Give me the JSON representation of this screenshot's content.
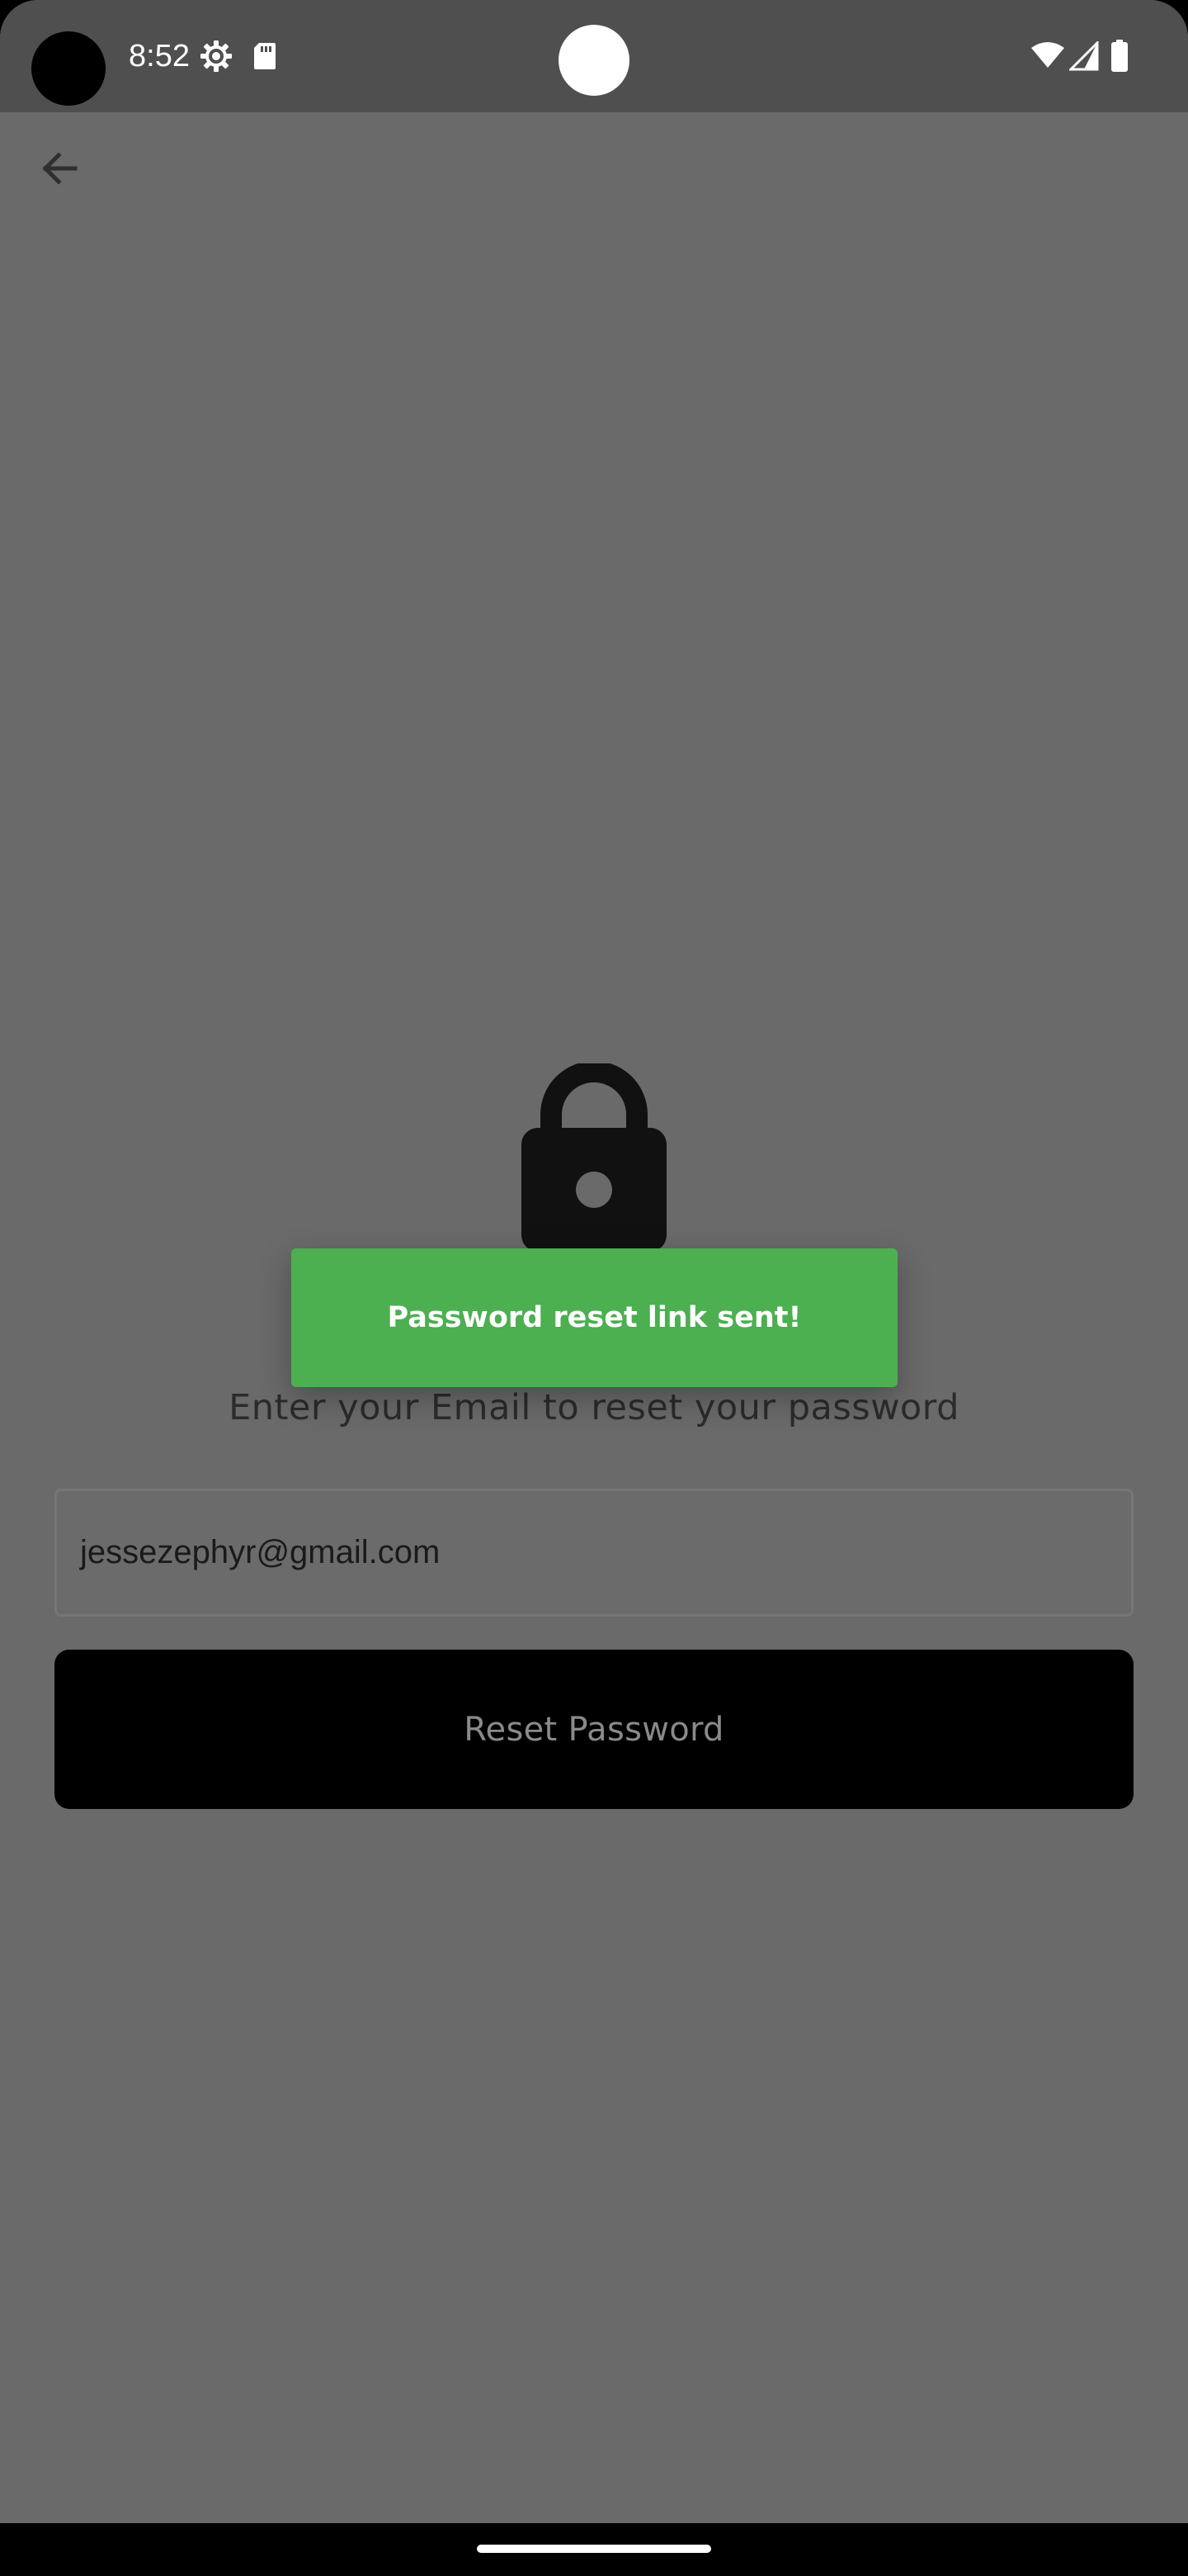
{
  "status_bar": {
    "time": "8:52",
    "icons": {
      "left": [
        "settings-gear-icon",
        "sd-card-icon"
      ],
      "right": [
        "wifi-icon",
        "cellular-signal-icon",
        "battery-icon"
      ]
    }
  },
  "header": {
    "back_icon": "arrow-left-icon"
  },
  "main": {
    "lock_icon": "lock-icon",
    "instruction": "Enter your Email to reset your password",
    "email": {
      "value": "jessezephyr@gmail.com"
    },
    "reset_button_label": "Reset Password"
  },
  "toast": {
    "message": "Password reset link sent!",
    "color": "#4caf50"
  },
  "colors": {
    "overlay_background": "#6a6a6a",
    "status_bar": "#4f4f4f",
    "button": "#000000",
    "button_text": "#8a8a8a"
  }
}
